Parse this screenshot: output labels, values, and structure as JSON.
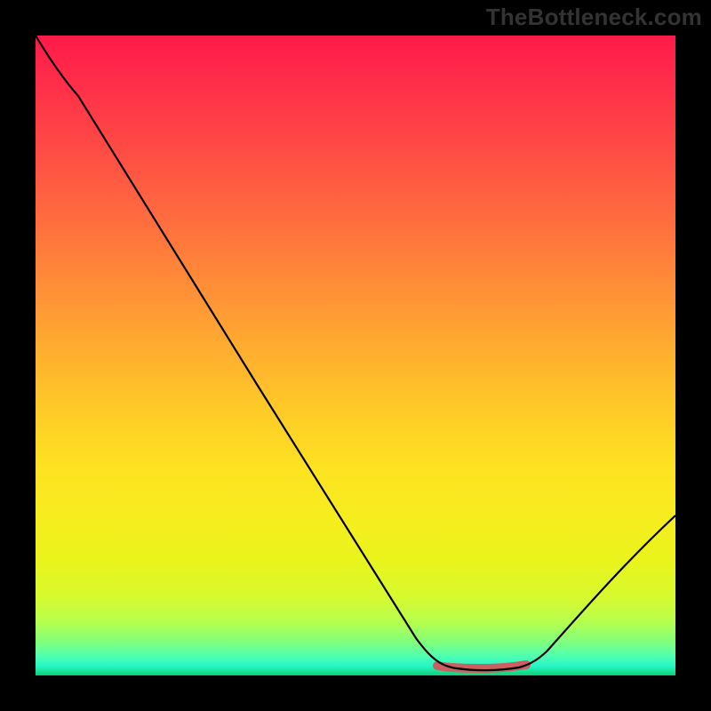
{
  "watermark": "TheBottleneck.com",
  "colors": {
    "frame": "#000000",
    "curve": "#000000",
    "highlight": "#cc6060",
    "gradient_top": "#ff1a4a",
    "gradient_mid": "#fde321",
    "gradient_bottom": "#0fcf74"
  },
  "chart_data": {
    "type": "line",
    "title": "",
    "xlabel": "",
    "ylabel": "",
    "x": [
      0.0,
      0.03,
      0.06,
      0.1,
      0.2,
      0.3,
      0.4,
      0.5,
      0.6,
      0.63,
      0.67,
      0.7,
      0.73,
      0.77,
      0.8,
      0.85,
      0.9,
      0.95,
      1.0
    ],
    "y": [
      1.0,
      0.96,
      0.92,
      0.86,
      0.7,
      0.54,
      0.38,
      0.22,
      0.06,
      0.03,
      0.015,
      0.012,
      0.012,
      0.015,
      0.02,
      0.06,
      0.12,
      0.18,
      0.25
    ],
    "xlim": [
      0,
      1
    ],
    "ylim": [
      0,
      1
    ],
    "highlight_region": {
      "x_start": 0.63,
      "x_end": 0.77,
      "y": 0.015
    },
    "annotations": []
  }
}
